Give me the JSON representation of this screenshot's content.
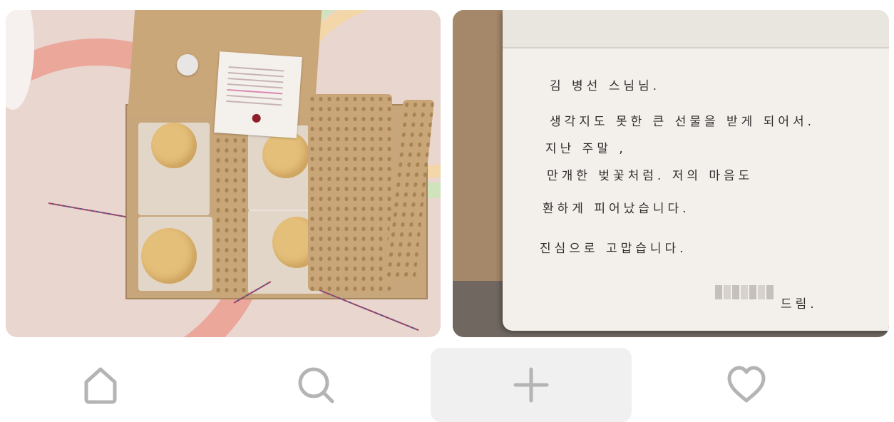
{
  "photo_1": {
    "icon": "gift-box-photo",
    "note_lines": 9
  },
  "photo_2": {
    "icon": "handwritten-card-photo",
    "lines": [
      "김 병선 스님님.",
      "생각지도 못한 큰 선물을 받게 되어서.",
      "지난 주말 ,",
      "만개한 벚꽃처럼. 저의 마음도",
      "환하게 피어났습니다.",
      "진심으로 고맙습니다.",
      "드림."
    ]
  },
  "nav": {
    "items": [
      {
        "icon": "home-icon"
      },
      {
        "icon": "search-icon"
      },
      {
        "icon": "plus-icon",
        "active": true
      },
      {
        "icon": "heart-icon"
      }
    ],
    "icon_color": "#b4b4b4",
    "active_bg": "#f0f0f0"
  }
}
